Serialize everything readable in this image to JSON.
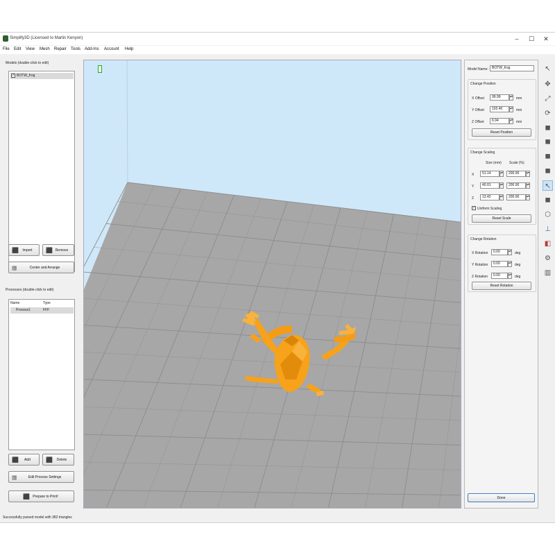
{
  "window": {
    "title": "Simplify3D (Licensed to Martin Kenyon)",
    "controls": {
      "minimize": "–",
      "maximize": "☐",
      "close": "✕"
    }
  },
  "menu": [
    "File",
    "Edit",
    "View",
    "Mesh",
    "Repair",
    "Tools",
    "Add-Ins",
    "Account",
    "Help"
  ],
  "models": {
    "label": "Models (double-click to edit)",
    "items": [
      {
        "name": "BOTW_frog",
        "checked": "✓"
      }
    ],
    "import_label": "Import",
    "remove_label": "Remove",
    "center_label": "Center and Arrange"
  },
  "processes": {
    "label": "Processes (double-click to edit)",
    "col_name": "Name",
    "col_type": "Type",
    "rows": [
      {
        "name": "Process1",
        "type": "FFF"
      }
    ],
    "add_label": "Add",
    "delete_label": "Delete",
    "edit_label": "Edit Process Settings",
    "prepare_label": "Prepare to Print!"
  },
  "model_panel": {
    "name_label": "Model Name:",
    "name_value": "BOTW_frog",
    "position": {
      "title": "Change Position",
      "x_label": "X Offset",
      "x_value": "99.99",
      "y_label": "Y Offset",
      "y_value": "102.40",
      "z_label": "Z Offset",
      "z_value": "6.94",
      "unit": "mm",
      "reset_label": "Reset Position"
    },
    "scaling": {
      "title": "Change Scaling",
      "size_header": "Size (mm)",
      "scale_header": "Scale (%)",
      "x_label": "X",
      "x_size": "51.14",
      "x_scale": "200.00",
      "y_label": "Y",
      "y_size": "40.01",
      "y_scale": "200.00",
      "z_label": "Z",
      "z_size": "13.42",
      "z_scale": "200.00",
      "uniform_label": "Uniform Scaling",
      "uniform_checked": "✓",
      "reset_label": "Reset Scale"
    },
    "rotation": {
      "title": "Change Rotation",
      "x_label": "X Rotation",
      "x_value": "0.00",
      "y_label": "Y Rotation",
      "y_value": "0.00",
      "z_label": "Z Rotation",
      "z_value": "0.00",
      "unit": "deg",
      "reset_label": "Reset Rotation"
    },
    "done_label": "Done"
  },
  "toolbar": [
    {
      "name": "select-tool-icon",
      "glyph": "↖"
    },
    {
      "name": "move-tool-icon",
      "glyph": "✥"
    },
    {
      "name": "scale-tool-icon",
      "glyph": "⤢"
    },
    {
      "name": "rotate-tool-icon",
      "glyph": "⟳"
    },
    {
      "name": "view-front-icon",
      "glyph": "◼"
    },
    {
      "name": "view-back-icon",
      "glyph": "◼"
    },
    {
      "name": "view-left-icon",
      "glyph": "◼"
    },
    {
      "name": "view-right-icon",
      "glyph": "◼"
    },
    {
      "name": "select-model-icon",
      "glyph": "↖"
    },
    {
      "name": "solid-view-icon",
      "glyph": "◼"
    },
    {
      "name": "wireframe-view-icon",
      "glyph": "⬡"
    },
    {
      "name": "place-surface-icon",
      "glyph": "⊥"
    },
    {
      "name": "cross-section-icon",
      "glyph": "◧"
    },
    {
      "name": "settings-gear-icon",
      "glyph": "⚙"
    },
    {
      "name": "build-volume-icon",
      "glyph": "▥"
    }
  ],
  "status": "Successfully parsed model with 382 triangles",
  "colors": {
    "viewport_bg": "#cfe8f9",
    "bed": "#a7a7a7",
    "grid": "#8c8c8c",
    "model": "#f7a21b",
    "model_shade": "#d98508"
  }
}
